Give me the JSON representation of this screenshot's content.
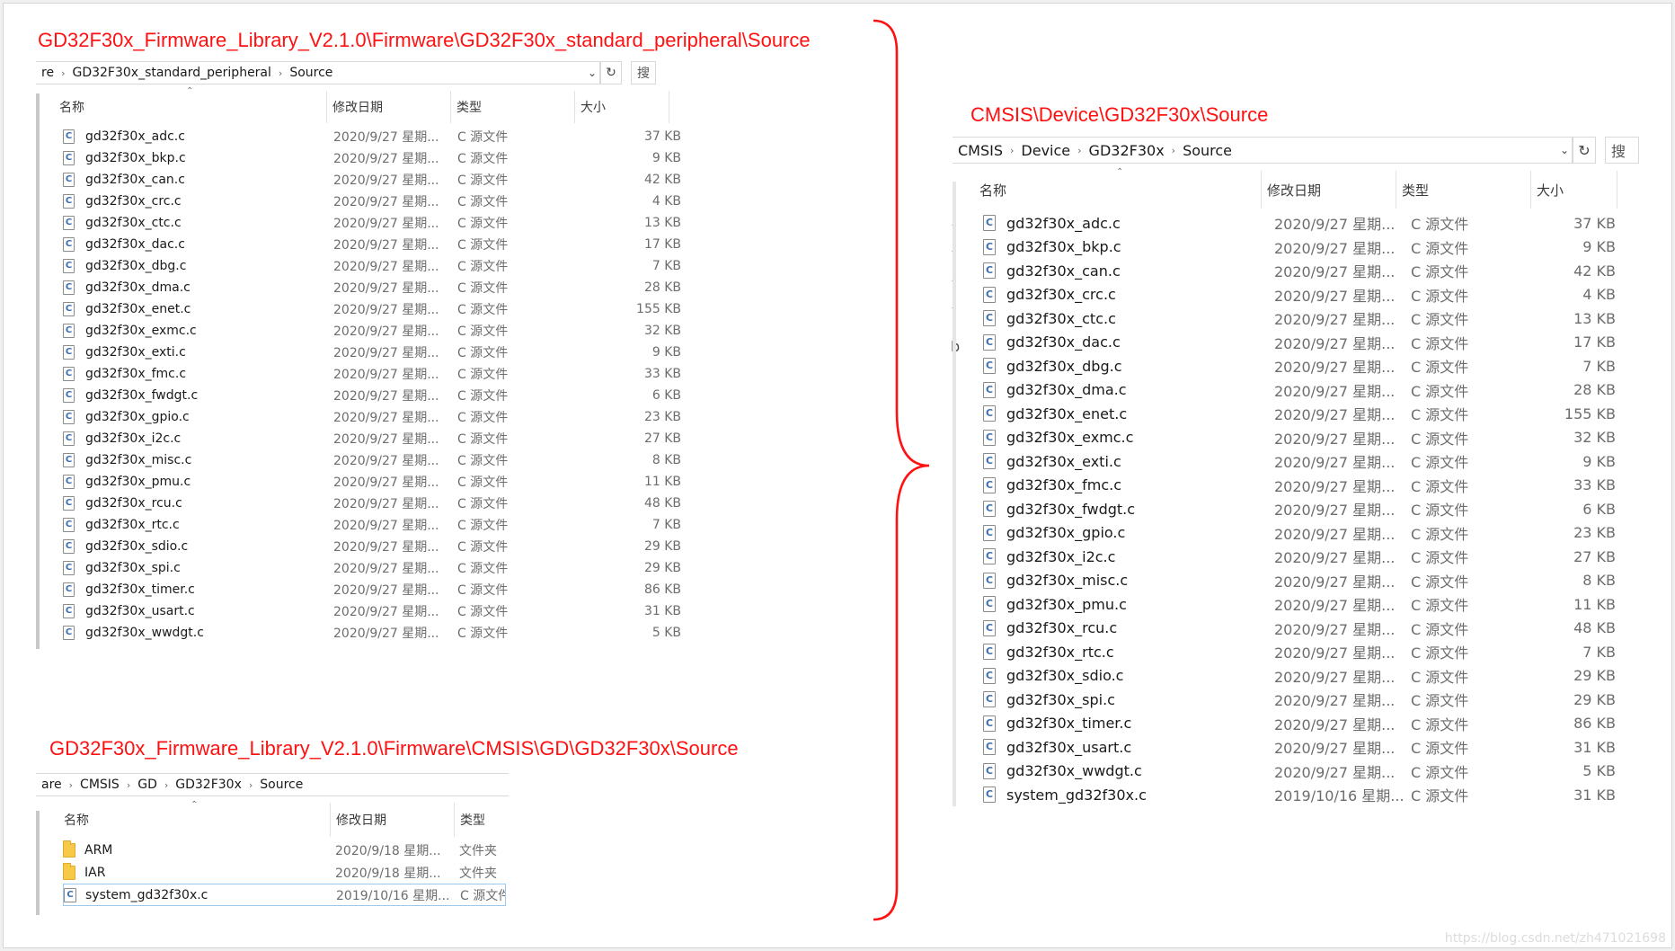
{
  "captions": {
    "top_left": "GD32F30x_Firmware_Library_V2.1.0\\Firmware\\GD32F30x_standard_peripheral\\Source",
    "bottom_left": "GD32F30x_Firmware_Library_V2.1.0\\Firmware\\CMSIS\\GD\\GD32F30x\\Source",
    "right": "CMSIS\\Device\\GD32F30x\\Source"
  },
  "columns": {
    "name": "名称",
    "modified": "修改日期",
    "type": "类型",
    "size": "大小"
  },
  "icons": {
    "refresh": "refresh-icon",
    "dropdown": "chevron-down-icon",
    "file": "c-file-icon",
    "folder": "folder-icon",
    "sort": "sort-up-icon"
  },
  "search_glyph": "搜",
  "file_icon_letter": "C",
  "edge_glyphs": [
    "-",
    "-",
    "-",
    "-",
    "b"
  ],
  "panel1": {
    "breadcrumb": [
      "re",
      "GD32F30x_standard_peripheral",
      "Source"
    ],
    "files": [
      {
        "name": "gd32f30x_adc.c",
        "date": "2020/9/27 星期...",
        "type": "C 源文件",
        "size": "37 KB"
      },
      {
        "name": "gd32f30x_bkp.c",
        "date": "2020/9/27 星期...",
        "type": "C 源文件",
        "size": "9 KB"
      },
      {
        "name": "gd32f30x_can.c",
        "date": "2020/9/27 星期...",
        "type": "C 源文件",
        "size": "42 KB"
      },
      {
        "name": "gd32f30x_crc.c",
        "date": "2020/9/27 星期...",
        "type": "C 源文件",
        "size": "4 KB"
      },
      {
        "name": "gd32f30x_ctc.c",
        "date": "2020/9/27 星期...",
        "type": "C 源文件",
        "size": "13 KB"
      },
      {
        "name": "gd32f30x_dac.c",
        "date": "2020/9/27 星期...",
        "type": "C 源文件",
        "size": "17 KB"
      },
      {
        "name": "gd32f30x_dbg.c",
        "date": "2020/9/27 星期...",
        "type": "C 源文件",
        "size": "7 KB"
      },
      {
        "name": "gd32f30x_dma.c",
        "date": "2020/9/27 星期...",
        "type": "C 源文件",
        "size": "28 KB"
      },
      {
        "name": "gd32f30x_enet.c",
        "date": "2020/9/27 星期...",
        "type": "C 源文件",
        "size": "155 KB"
      },
      {
        "name": "gd32f30x_exmc.c",
        "date": "2020/9/27 星期...",
        "type": "C 源文件",
        "size": "32 KB"
      },
      {
        "name": "gd32f30x_exti.c",
        "date": "2020/9/27 星期...",
        "type": "C 源文件",
        "size": "9 KB"
      },
      {
        "name": "gd32f30x_fmc.c",
        "date": "2020/9/27 星期...",
        "type": "C 源文件",
        "size": "33 KB"
      },
      {
        "name": "gd32f30x_fwdgt.c",
        "date": "2020/9/27 星期...",
        "type": "C 源文件",
        "size": "6 KB"
      },
      {
        "name": "gd32f30x_gpio.c",
        "date": "2020/9/27 星期...",
        "type": "C 源文件",
        "size": "23 KB"
      },
      {
        "name": "gd32f30x_i2c.c",
        "date": "2020/9/27 星期...",
        "type": "C 源文件",
        "size": "27 KB"
      },
      {
        "name": "gd32f30x_misc.c",
        "date": "2020/9/27 星期...",
        "type": "C 源文件",
        "size": "8 KB"
      },
      {
        "name": "gd32f30x_pmu.c",
        "date": "2020/9/27 星期...",
        "type": "C 源文件",
        "size": "11 KB"
      },
      {
        "name": "gd32f30x_rcu.c",
        "date": "2020/9/27 星期...",
        "type": "C 源文件",
        "size": "48 KB"
      },
      {
        "name": "gd32f30x_rtc.c",
        "date": "2020/9/27 星期...",
        "type": "C 源文件",
        "size": "7 KB"
      },
      {
        "name": "gd32f30x_sdio.c",
        "date": "2020/9/27 星期...",
        "type": "C 源文件",
        "size": "29 KB"
      },
      {
        "name": "gd32f30x_spi.c",
        "date": "2020/9/27 星期...",
        "type": "C 源文件",
        "size": "29 KB"
      },
      {
        "name": "gd32f30x_timer.c",
        "date": "2020/9/27 星期...",
        "type": "C 源文件",
        "size": "86 KB"
      },
      {
        "name": "gd32f30x_usart.c",
        "date": "2020/9/27 星期...",
        "type": "C 源文件",
        "size": "31 KB"
      },
      {
        "name": "gd32f30x_wwdgt.c",
        "date": "2020/9/27 星期...",
        "type": "C 源文件",
        "size": "5 KB"
      }
    ]
  },
  "panel2": {
    "breadcrumb": [
      "are",
      "CMSIS",
      "GD",
      "GD32F30x",
      "Source"
    ],
    "files": [
      {
        "kind": "folder",
        "name": "ARM",
        "date": "2020/9/18 星期...",
        "type": "文件夹"
      },
      {
        "kind": "folder",
        "name": "IAR",
        "date": "2020/9/18 星期...",
        "type": "文件夹"
      },
      {
        "kind": "file",
        "name": "system_gd32f30x.c",
        "date": "2019/10/16 星期...",
        "type": "C 源文件"
      }
    ]
  },
  "panel3": {
    "breadcrumb": [
      "CMSIS",
      "Device",
      "GD32F30x",
      "Source"
    ],
    "files": [
      {
        "name": "gd32f30x_adc.c",
        "date": "2020/9/27 星期...",
        "type": "C 源文件",
        "size": "37 KB"
      },
      {
        "name": "gd32f30x_bkp.c",
        "date": "2020/9/27 星期...",
        "type": "C 源文件",
        "size": "9 KB"
      },
      {
        "name": "gd32f30x_can.c",
        "date": "2020/9/27 星期...",
        "type": "C 源文件",
        "size": "42 KB"
      },
      {
        "name": "gd32f30x_crc.c",
        "date": "2020/9/27 星期...",
        "type": "C 源文件",
        "size": "4 KB"
      },
      {
        "name": "gd32f30x_ctc.c",
        "date": "2020/9/27 星期...",
        "type": "C 源文件",
        "size": "13 KB"
      },
      {
        "name": "gd32f30x_dac.c",
        "date": "2020/9/27 星期...",
        "type": "C 源文件",
        "size": "17 KB"
      },
      {
        "name": "gd32f30x_dbg.c",
        "date": "2020/9/27 星期...",
        "type": "C 源文件",
        "size": "7 KB"
      },
      {
        "name": "gd32f30x_dma.c",
        "date": "2020/9/27 星期...",
        "type": "C 源文件",
        "size": "28 KB"
      },
      {
        "name": "gd32f30x_enet.c",
        "date": "2020/9/27 星期...",
        "type": "C 源文件",
        "size": "155 KB"
      },
      {
        "name": "gd32f30x_exmc.c",
        "date": "2020/9/27 星期...",
        "type": "C 源文件",
        "size": "32 KB"
      },
      {
        "name": "gd32f30x_exti.c",
        "date": "2020/9/27 星期...",
        "type": "C 源文件",
        "size": "9 KB"
      },
      {
        "name": "gd32f30x_fmc.c",
        "date": "2020/9/27 星期...",
        "type": "C 源文件",
        "size": "33 KB"
      },
      {
        "name": "gd32f30x_fwdgt.c",
        "date": "2020/9/27 星期...",
        "type": "C 源文件",
        "size": "6 KB"
      },
      {
        "name": "gd32f30x_gpio.c",
        "date": "2020/9/27 星期...",
        "type": "C 源文件",
        "size": "23 KB"
      },
      {
        "name": "gd32f30x_i2c.c",
        "date": "2020/9/27 星期...",
        "type": "C 源文件",
        "size": "27 KB"
      },
      {
        "name": "gd32f30x_misc.c",
        "date": "2020/9/27 星期...",
        "type": "C 源文件",
        "size": "8 KB"
      },
      {
        "name": "gd32f30x_pmu.c",
        "date": "2020/9/27 星期...",
        "type": "C 源文件",
        "size": "11 KB"
      },
      {
        "name": "gd32f30x_rcu.c",
        "date": "2020/9/27 星期...",
        "type": "C 源文件",
        "size": "48 KB"
      },
      {
        "name": "gd32f30x_rtc.c",
        "date": "2020/9/27 星期...",
        "type": "C 源文件",
        "size": "7 KB"
      },
      {
        "name": "gd32f30x_sdio.c",
        "date": "2020/9/27 星期...",
        "type": "C 源文件",
        "size": "29 KB"
      },
      {
        "name": "gd32f30x_spi.c",
        "date": "2020/9/27 星期...",
        "type": "C 源文件",
        "size": "29 KB"
      },
      {
        "name": "gd32f30x_timer.c",
        "date": "2020/9/27 星期...",
        "type": "C 源文件",
        "size": "86 KB"
      },
      {
        "name": "gd32f30x_usart.c",
        "date": "2020/9/27 星期...",
        "type": "C 源文件",
        "size": "31 KB"
      },
      {
        "name": "gd32f30x_wwdgt.c",
        "date": "2020/9/27 星期...",
        "type": "C 源文件",
        "size": "5 KB"
      },
      {
        "name": "system_gd32f30x.c",
        "date": "2019/10/16 星期...",
        "type": "C 源文件",
        "size": "31 KB"
      }
    ]
  },
  "watermark": "https://blog.csdn.net/zh471021698"
}
